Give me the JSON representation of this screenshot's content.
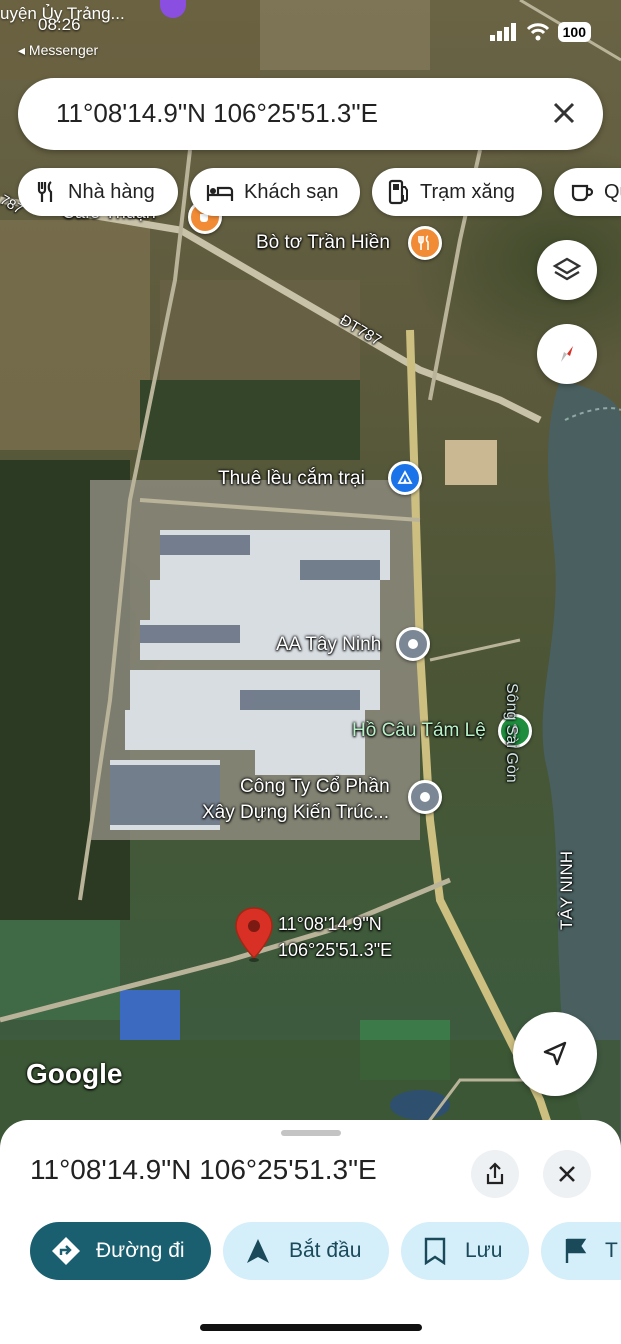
{
  "status": {
    "app_back_label": "uyện Ủy Trảng...",
    "back_app": "◂ Messenger",
    "time": "08:26",
    "battery": "100"
  },
  "search": {
    "query": "11°08'14.9\"N 106°25'51.3\"E"
  },
  "chips": [
    {
      "label": "Nhà hàng",
      "icon": "fork-knife-icon"
    },
    {
      "label": "Khách sạn",
      "icon": "bed-icon"
    },
    {
      "label": "Trạm xăng",
      "icon": "gas-pump-icon"
    },
    {
      "label": "Qu",
      "icon": "coffee-cup-icon"
    }
  ],
  "map": {
    "road_label": "ĐT787",
    "road_label_left": "787",
    "places": {
      "cafe": "Cafe Thuận",
      "bo_to": "Bò tơ Trần Hiền",
      "camping": "Thuê lều cắm trại",
      "aa": "AA Tây Ninh",
      "ho_cau": "Hồ Câu Tám Lệ",
      "cong_ty_line1": "Công Ty Cổ Phần",
      "cong_ty_line2": "Xây Dựng Kiến Trúc..."
    },
    "river": "Sông Sài Gòn",
    "province": "TÂY NINH",
    "pin_lat": "11°08'14.9\"N",
    "pin_lng": "106°25'51.3\"E",
    "logo": "Google"
  },
  "sheet": {
    "title": "11°08'14.9\"N 106°25'51.3\"E",
    "actions": [
      {
        "label": "Đường đi",
        "primary": true
      },
      {
        "label": "Bắt đầu",
        "primary": false
      },
      {
        "label": "Lưu",
        "primary": false
      },
      {
        "label": "T",
        "primary": false
      }
    ]
  },
  "colors": {
    "primary": "#1a5f6f",
    "secondary_bg": "#d4eefa",
    "pin_red": "#d93025",
    "food_orange": "#f28b36",
    "poi_blue": "#1a73e8",
    "poi_grey": "#7b8794",
    "green_poi": "#1e8e3e"
  }
}
